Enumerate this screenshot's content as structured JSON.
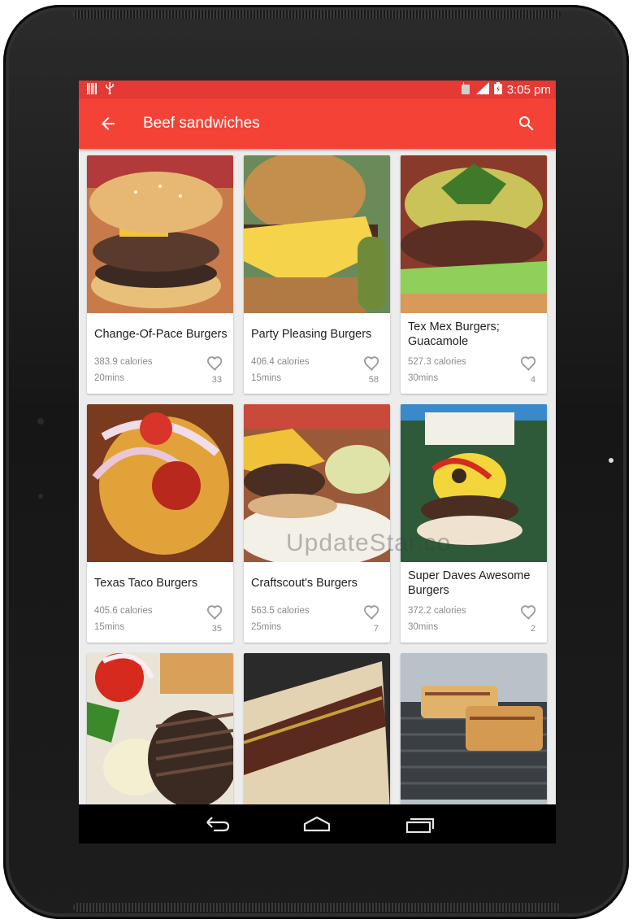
{
  "status_bar": {
    "time": "3:05 pm",
    "icons": [
      "barcode-icon",
      "usb-icon",
      "alarm-icon",
      "signal-icon",
      "battery-charging-icon"
    ]
  },
  "app_bar": {
    "title": "Beef sandwiches",
    "back_icon": "arrow-back-icon",
    "search_icon": "search-icon"
  },
  "recipes": [
    {
      "name": "Change-Of-Pace Burgers",
      "calories": "383.9 calories",
      "time": "20mins",
      "likes": "33"
    },
    {
      "name": "Party Pleasing Burgers",
      "calories": "406.4 calories",
      "time": "15mins",
      "likes": "58"
    },
    {
      "name": "Tex Mex Burgers; Guacamole",
      "calories": "527.3 calories",
      "time": "30mins",
      "likes": "4"
    },
    {
      "name": "Texas Taco Burgers",
      "calories": "405.6 calories",
      "time": "15mins",
      "likes": "35"
    },
    {
      "name": "Craftscout's Burgers",
      "calories": "563.5 calories",
      "time": "25mins",
      "likes": "7"
    },
    {
      "name": "Super Daves Awesome Burgers",
      "calories": "372.2 calories",
      "time": "30mins",
      "likes": "2"
    }
  ],
  "nav_bar": {
    "buttons": [
      "back-nav-icon",
      "home-nav-icon",
      "recents-nav-icon"
    ]
  },
  "watermark": "UpdateStar.co",
  "colors": {
    "status_bar": "#e53935",
    "app_bar": "#f44336",
    "text_primary": "#212121",
    "text_secondary": "#8a8a8a"
  }
}
